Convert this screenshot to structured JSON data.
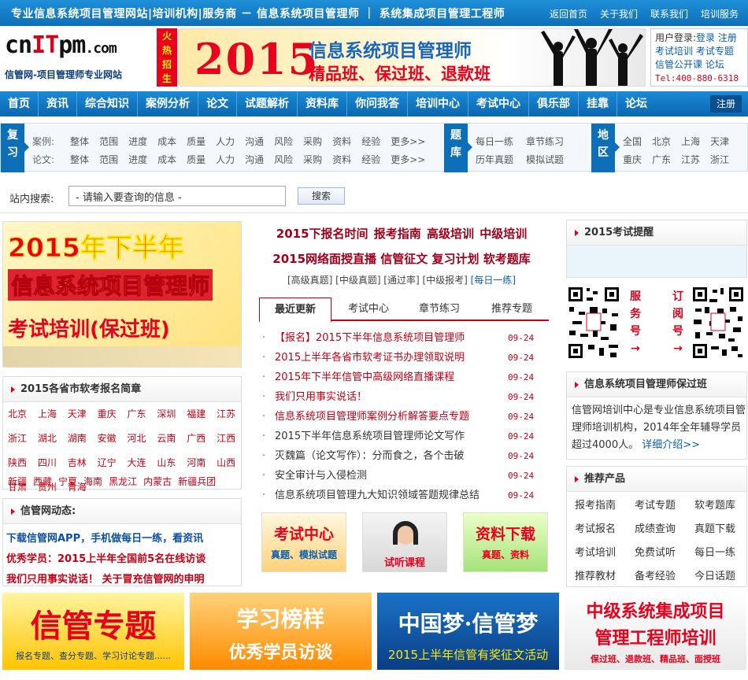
{
  "topbar": {
    "tagline": "专业信息系统项目管理网站|培训机构|服务商 － 信息系统项目管理师 ｜ 系统集成项目管理工程师",
    "links": [
      "返回首页",
      "关于我们",
      "联系我们",
      "培训服务"
    ]
  },
  "logo": {
    "part1": "cn",
    "part2": "IT",
    "part3": "pm",
    "part4": ".com",
    "subtitle": "信管网-项目管理师专业网站"
  },
  "hot_tag": [
    "火",
    "热",
    "招",
    "生"
  ],
  "banner": {
    "year": "2015",
    "title": "信息系统项目管理师",
    "subtitle": "精品班、保过班、退款班"
  },
  "login": {
    "label": "用户登录:",
    "login": "登录",
    "register": "注册",
    "line2a": "考试培训",
    "line2b": "考试专题",
    "line3a": "信管公开课",
    "line3b": "论坛",
    "tel": "Tel:400-880-6318"
  },
  "nav": {
    "items": [
      "首页",
      "资讯",
      "综合知识",
      "案例分析",
      "论文",
      "试题解析",
      "资料库",
      "你问我答",
      "培训中心",
      "考试中心",
      "俱乐部",
      "挂靠",
      "论坛"
    ],
    "register": "注册"
  },
  "quick": {
    "review_tag": [
      "复",
      "习"
    ],
    "case_label": "案例:",
    "paper_label": "论文:",
    "topics": [
      "整体",
      "范围",
      "进度",
      "成本",
      "质量",
      "人力",
      "沟通",
      "风险",
      "采购",
      "资料",
      "经验",
      "更多>>"
    ],
    "bank_tag": [
      "题",
      "库"
    ],
    "bank_items": [
      "每日一练",
      "章节练习",
      "历年真题",
      "模拟试题"
    ],
    "region_tag": [
      "地",
      "区"
    ],
    "regions": [
      "全国",
      "北京",
      "上海",
      "天津",
      "重庆",
      "广东",
      "江苏",
      "浙江"
    ]
  },
  "search": {
    "label": "站内搜索:",
    "value": "- 请输入要查询的信息 -",
    "button": "搜索"
  },
  "promo": {
    "line1": "2015年下半年",
    "line2": "信息系统项目管理师",
    "line3": "考试培训(保过班)"
  },
  "provinces": {
    "title": "2015各省市软考报名简章",
    "items": [
      "北京",
      "上海",
      "天津",
      "重庆",
      "广东",
      "深圳",
      "福建",
      "江苏",
      "浙江",
      "湖北",
      "湖南",
      "安徽",
      "河北",
      "云南",
      "广西",
      "江西",
      "陕西",
      "四川",
      "吉林",
      "辽宁",
      "大连",
      "山东",
      "河南",
      "山西",
      "甘肃",
      "贵州",
      "青海",
      "新疆",
      "西藏",
      "宁夏",
      "海南",
      "黑龙江",
      "内蒙古",
      "新疆兵团"
    ]
  },
  "dynamics": {
    "title": "信管网动态:",
    "line1": "下载信管网APP，手机做每日一练，看资讯",
    "line2": "优秀学员：2015上半年全国前5名在线访谈",
    "line3": "我们只用事实说话！ 关于冒充信管网的申明"
  },
  "center": {
    "hot1": "2015下报名时间 报考指南 高级培训 中级培训",
    "hot2": "2015网络面授直播 信管征文 复习计划 软考题库",
    "hot3_a": "[高级真题] [中级真题] [通过率] [中级报考] ",
    "hot3_b": "[每日一练]",
    "tabs": [
      "最近更新",
      "考试中心",
      "章节练习",
      "推荐专题"
    ],
    "list": [
      {
        "title": "【报名】2015下半年信息系统项目管理师",
        "date": "09-24"
      },
      {
        "title": "2015上半年各省市软考证书办理领取说明",
        "date": "09-24"
      },
      {
        "title": "2015年下半年信管中高级网络直播课程",
        "date": "09-24"
      },
      {
        "title": "我们只用事实说话！",
        "date": "09-24"
      },
      {
        "title": "信息系统项目管理师案例分析解答要点专题",
        "date": "09-24"
      },
      {
        "title": "2015下半年信息系统项目管理师论文写作",
        "date": "09-24"
      },
      {
        "title": "灭魏篇（论文写作）：分而食之，各个击破",
        "date": "09-24"
      },
      {
        "title": "安全审计与入侵检测",
        "date": "09-24"
      },
      {
        "title": "信息系统项目管理九大知识领域答题规律总结",
        "date": "09-24"
      }
    ],
    "tile1_big": "考试中心",
    "tile1_small": "真题、模拟试题",
    "tile2_big": "试听课程",
    "tile3_big": "资料下载",
    "tile3_small": "真题、资料"
  },
  "right": {
    "remind_title": "2015考试提醒",
    "qr_mid": [
      "服",
      "务",
      "号",
      "→"
    ],
    "qr_mid2": [
      "订",
      "阅",
      "号",
      "→"
    ],
    "pass_title": "信息系统项目管理师保过班",
    "pass_text": "信管网培训中心是专业信息系统项目管理师培训机构，2014年全年辅导学员超过4000人。",
    "pass_more": "详细介绍>>",
    "prod_title": "推荐产品",
    "products": [
      "报考指南",
      "考试专题",
      "软考题库",
      "考试报名",
      "成绩查询",
      "真题下载",
      "考试培训",
      "免费试听",
      "每日一练",
      "推荐教材",
      "备考经验",
      "今日话题"
    ]
  },
  "bottom": {
    "b1_big": "信管专题",
    "b1_small": "报名专题、查分专题、学习讨论专题......",
    "b2_big": "学习榜样",
    "b2_small": "优秀学员访谈",
    "b3_big": "中国梦·信管梦",
    "b3_small": "2015上半年信管有奖征文活动",
    "b4_big1": "中级系统集成项目",
    "b4_big2": "管理工程师培训",
    "b4_small": "保过班、退款班、精品班、面授班"
  }
}
